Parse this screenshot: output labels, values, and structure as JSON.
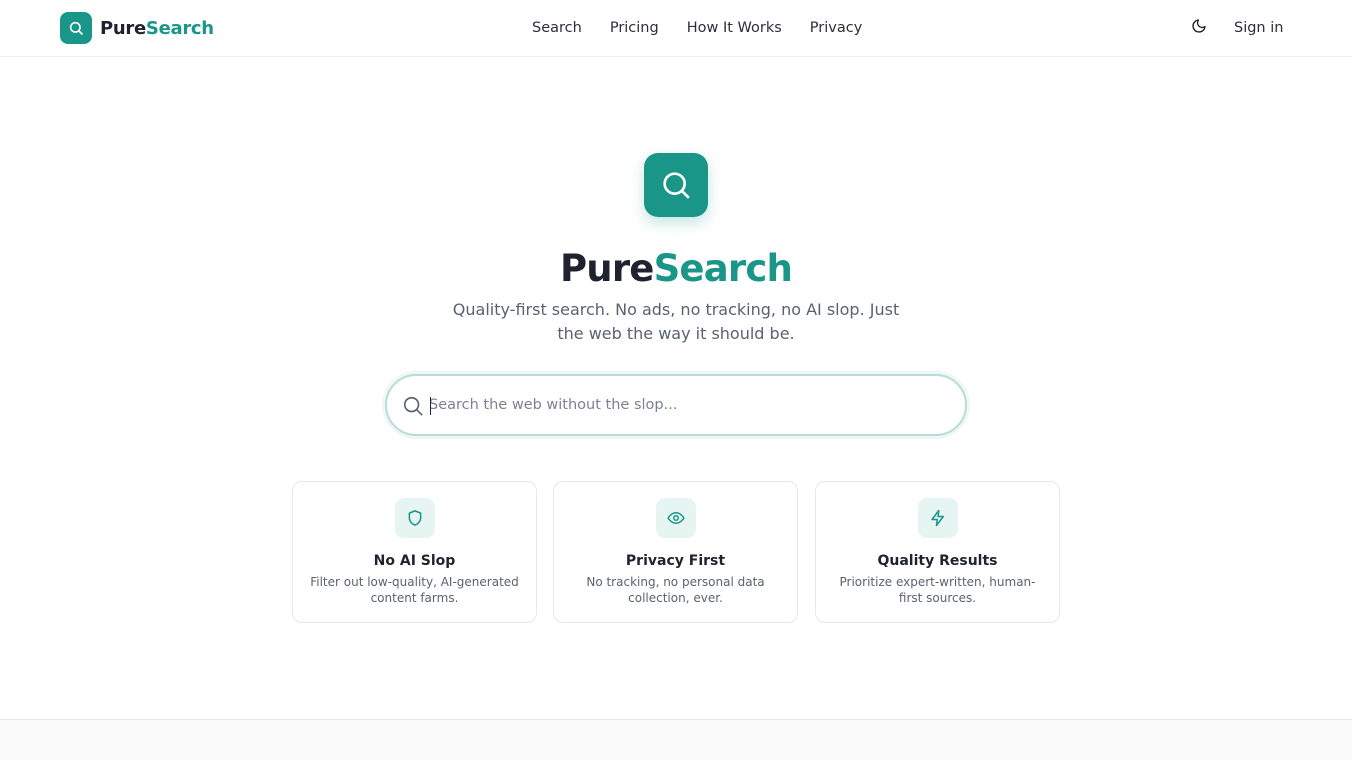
{
  "header": {
    "logo_part1": "Pure",
    "logo_part2": "Search",
    "logo_icon": "search-icon",
    "nav": [
      "Search",
      "Pricing",
      "How It Works",
      "Privacy"
    ],
    "theme_toggle_icon": "moon-icon",
    "signin_label": "Sign in"
  },
  "hero": {
    "icon": "search-icon",
    "title_part1": "Pure",
    "title_part2": "Search",
    "subtitle": "Quality-first search. No ads, no tracking, no AI slop. Just the web the way it should be."
  },
  "search": {
    "placeholder": "Search the web without the slop...",
    "value": ""
  },
  "features": [
    {
      "icon": "shield-icon",
      "title": "No AI Slop",
      "description": "Filter out low-quality, AI-generated content farms."
    },
    {
      "icon": "eye-icon",
      "title": "Privacy First",
      "description": "No tracking, no personal data collection, ever."
    },
    {
      "icon": "lightning-icon",
      "title": "Quality Results",
      "description": "Prioritize expert-written, human-first sources."
    }
  ],
  "colors": {
    "brand": "#1a9688",
    "text": "#1f2330",
    "muted": "#5a6270",
    "icon_bg": "#e6f4f2"
  }
}
